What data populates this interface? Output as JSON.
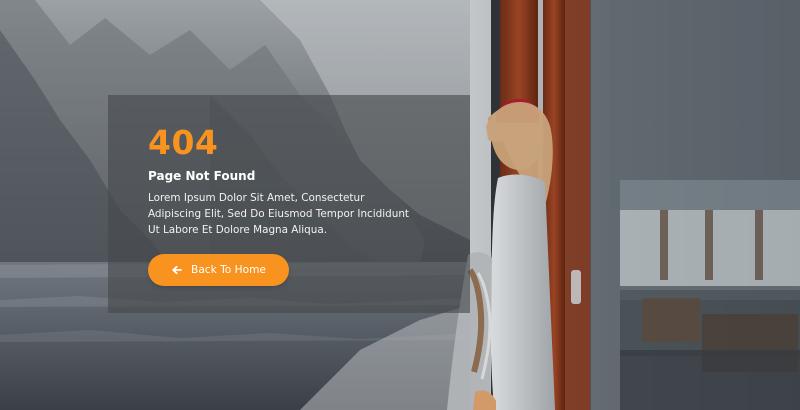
{
  "error": {
    "code": "404",
    "title": "Page Not Found",
    "message": "Lorem Ipsum Dolor Sit Amet, Consectetur Adipiscing Elit, Sed Do Eiusmod Tempor Incididunt Ut Labore Et Dolore Magna Aliqua."
  },
  "actions": {
    "back_label": "Back To Home",
    "back_icon": "arrow-left-icon"
  },
  "colors": {
    "accent": "#f7931e",
    "text_primary": "#ffffff",
    "panel_overlay": "#46484c"
  }
}
